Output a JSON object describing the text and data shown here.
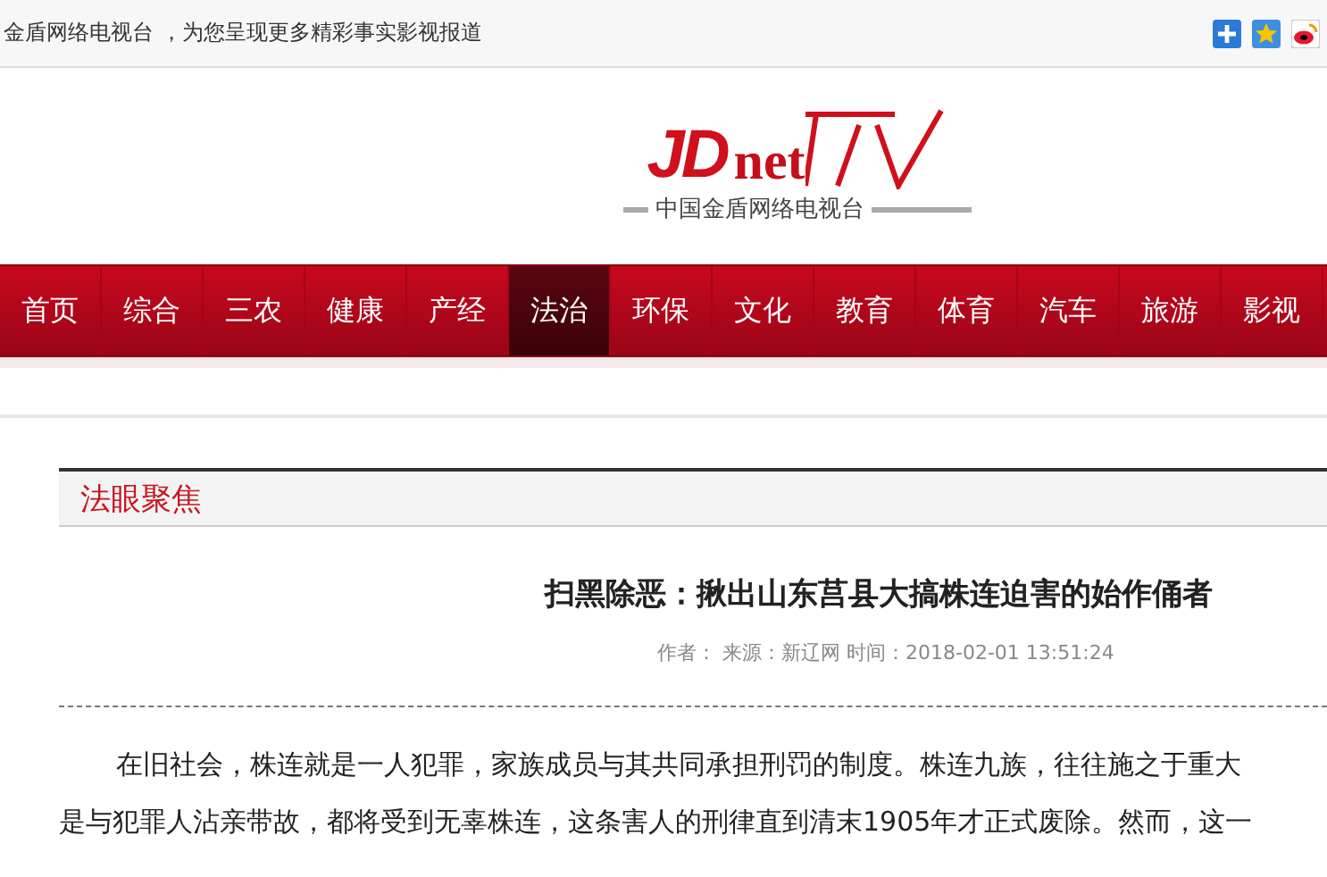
{
  "top_bar": {
    "tagline": "金盾网络电视台 ，为您呈现更多精彩事实影视报道"
  },
  "logo": {
    "letters": "JD",
    "word": "net",
    "subtitle": "中国金盾网络电视台"
  },
  "nav": [
    {
      "label": "首页",
      "selected": false
    },
    {
      "label": "综合",
      "selected": false
    },
    {
      "label": "三农",
      "selected": false
    },
    {
      "label": "健康",
      "selected": false
    },
    {
      "label": "产经",
      "selected": false
    },
    {
      "label": "法治",
      "selected": true
    },
    {
      "label": "环保",
      "selected": false
    },
    {
      "label": "文化",
      "selected": false
    },
    {
      "label": "教育",
      "selected": false
    },
    {
      "label": "体育",
      "selected": false
    },
    {
      "label": "汽车",
      "selected": false
    },
    {
      "label": "旅游",
      "selected": false
    },
    {
      "label": "影视",
      "selected": false
    }
  ],
  "section": {
    "title": "法眼聚焦"
  },
  "article": {
    "title": "扫黑除恶：揪出山东莒县大搞株连迫害的始作俑者",
    "meta": "作者：  来源：新辽网 时间：2018-02-01 13:51:24",
    "lines": [
      "在旧社会，株连就是一人犯罪，家族成员与其共同承担刑罚的制度。株连九族，往往施之于重大",
      "是与犯罪人沾亲带故，都将受到无辜株连，这条害人的刑律直到清末1905年才正式废除。然而，这一"
    ]
  }
}
